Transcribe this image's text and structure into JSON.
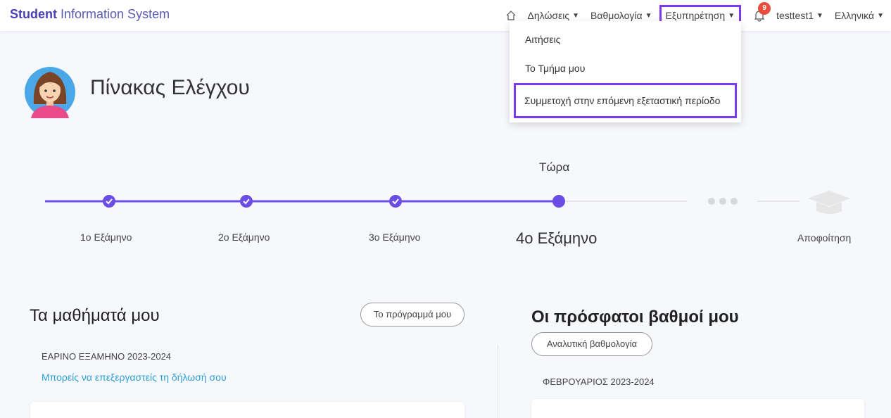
{
  "header": {
    "brand_strong": "Student",
    "brand_light": "Information System",
    "menus": {
      "declarations": "Δηλώσεις",
      "grading": "Βαθμολογία",
      "services": "Εξυπηρέτηση",
      "user": "testtest1",
      "language": "Ελληνικά"
    },
    "notification_count": "9"
  },
  "dropdown": {
    "items": [
      "Αιτήσεις",
      "Το Τμήμα μου",
      "Συμμετοχή στην επόμενη εξεταστική περίοδο"
    ]
  },
  "page": {
    "title": "Πίνακας Ελέγχου"
  },
  "timeline": {
    "now_label": "Τώρα",
    "semesters": [
      "1ο Εξάμηνο",
      "2ο Εξάμηνο",
      "3ο Εξάμηνο",
      "4ο Εξάμηνο"
    ],
    "graduation": "Αποφοίτηση",
    "completed_count": 3,
    "current_index": 3
  },
  "courses": {
    "title": "Τα μαθήματά μου",
    "schedule_button": "Το πρόγραμμά μου",
    "semester": "ΕΑΡΙΝΟ ΕΞΑΜΗΝΟ 2023-2024",
    "edit_link": "Μπορείς να επεξεργαστείς τη δήλωσή σου"
  },
  "grades": {
    "title": "Οι πρόσφατοι βαθμοί μου",
    "detailed_button": "Αναλυτική βαθμολογία",
    "period": "ΦΕΒΡΟΥΑΡΙΟΣ 2023-2024"
  },
  "colors": {
    "accent": "#6b4de6",
    "highlight": "#7c3aed",
    "link": "#2a9fd6",
    "badge": "#e74c3c"
  }
}
